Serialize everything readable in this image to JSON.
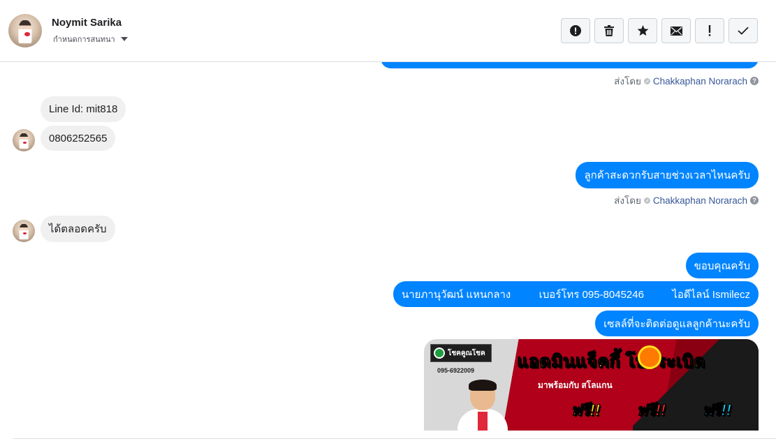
{
  "conversation": {
    "contact_name": "Noymit Sarika",
    "assign_label": "กำหนดการสนทนา"
  },
  "toolbar": {
    "buttons": [
      {
        "name": "report-spam",
        "icon": "alert-circle-icon"
      },
      {
        "name": "delete",
        "icon": "trash-icon"
      },
      {
        "name": "star",
        "icon": "star-icon"
      },
      {
        "name": "mark-unread",
        "icon": "envelope-icon"
      },
      {
        "name": "follow-up",
        "icon": "exclamation-icon"
      },
      {
        "name": "mark-done",
        "icon": "check-icon"
      }
    ]
  },
  "sent_by": {
    "prefix": "ส่งโดย",
    "agent": "Chakkaphan Norarach",
    "help_glyph": "?"
  },
  "messages": {
    "in_line_id": "Line Id: mit818",
    "in_phone": "0806252565",
    "out_question": "ลูกค้าสะดวกรับสายช่วงเวลาไหนครับ",
    "in_anytime": "ได้ตลอดครับ",
    "out_thanks": "ขอบคุณครับ",
    "out_contact_name": "นายภานุวัฒน์ แหนกลาง",
    "out_contact_phone": "เบอร์โทร 095-8045246",
    "out_contact_line": "ไอดีไลน์ Ismilecz",
    "out_sales_note": "เซลล์ที่จะติดต่อดูแลลูกค้านะครับ"
  },
  "promo": {
    "brand": "โชคคูณโชค",
    "phone": "095-6922009",
    "title": "แอดมินแจ็คกี้ โปรระเบิด",
    "subtitle": "มาพร้อมกับ สโลแกน",
    "free": [
      "ฟรี!!",
      "ฟรี!!",
      "ฟรี!!"
    ],
    "colors": {
      "title": "#ffe11a",
      "free_1": "#ffe11a",
      "free_2": "#ff2a2a",
      "free_3": "#1bd3ff"
    }
  },
  "colors": {
    "outgoing_bubble": "#0084ff",
    "incoming_bubble": "#f1f0f0",
    "agent_link": "#385898"
  }
}
